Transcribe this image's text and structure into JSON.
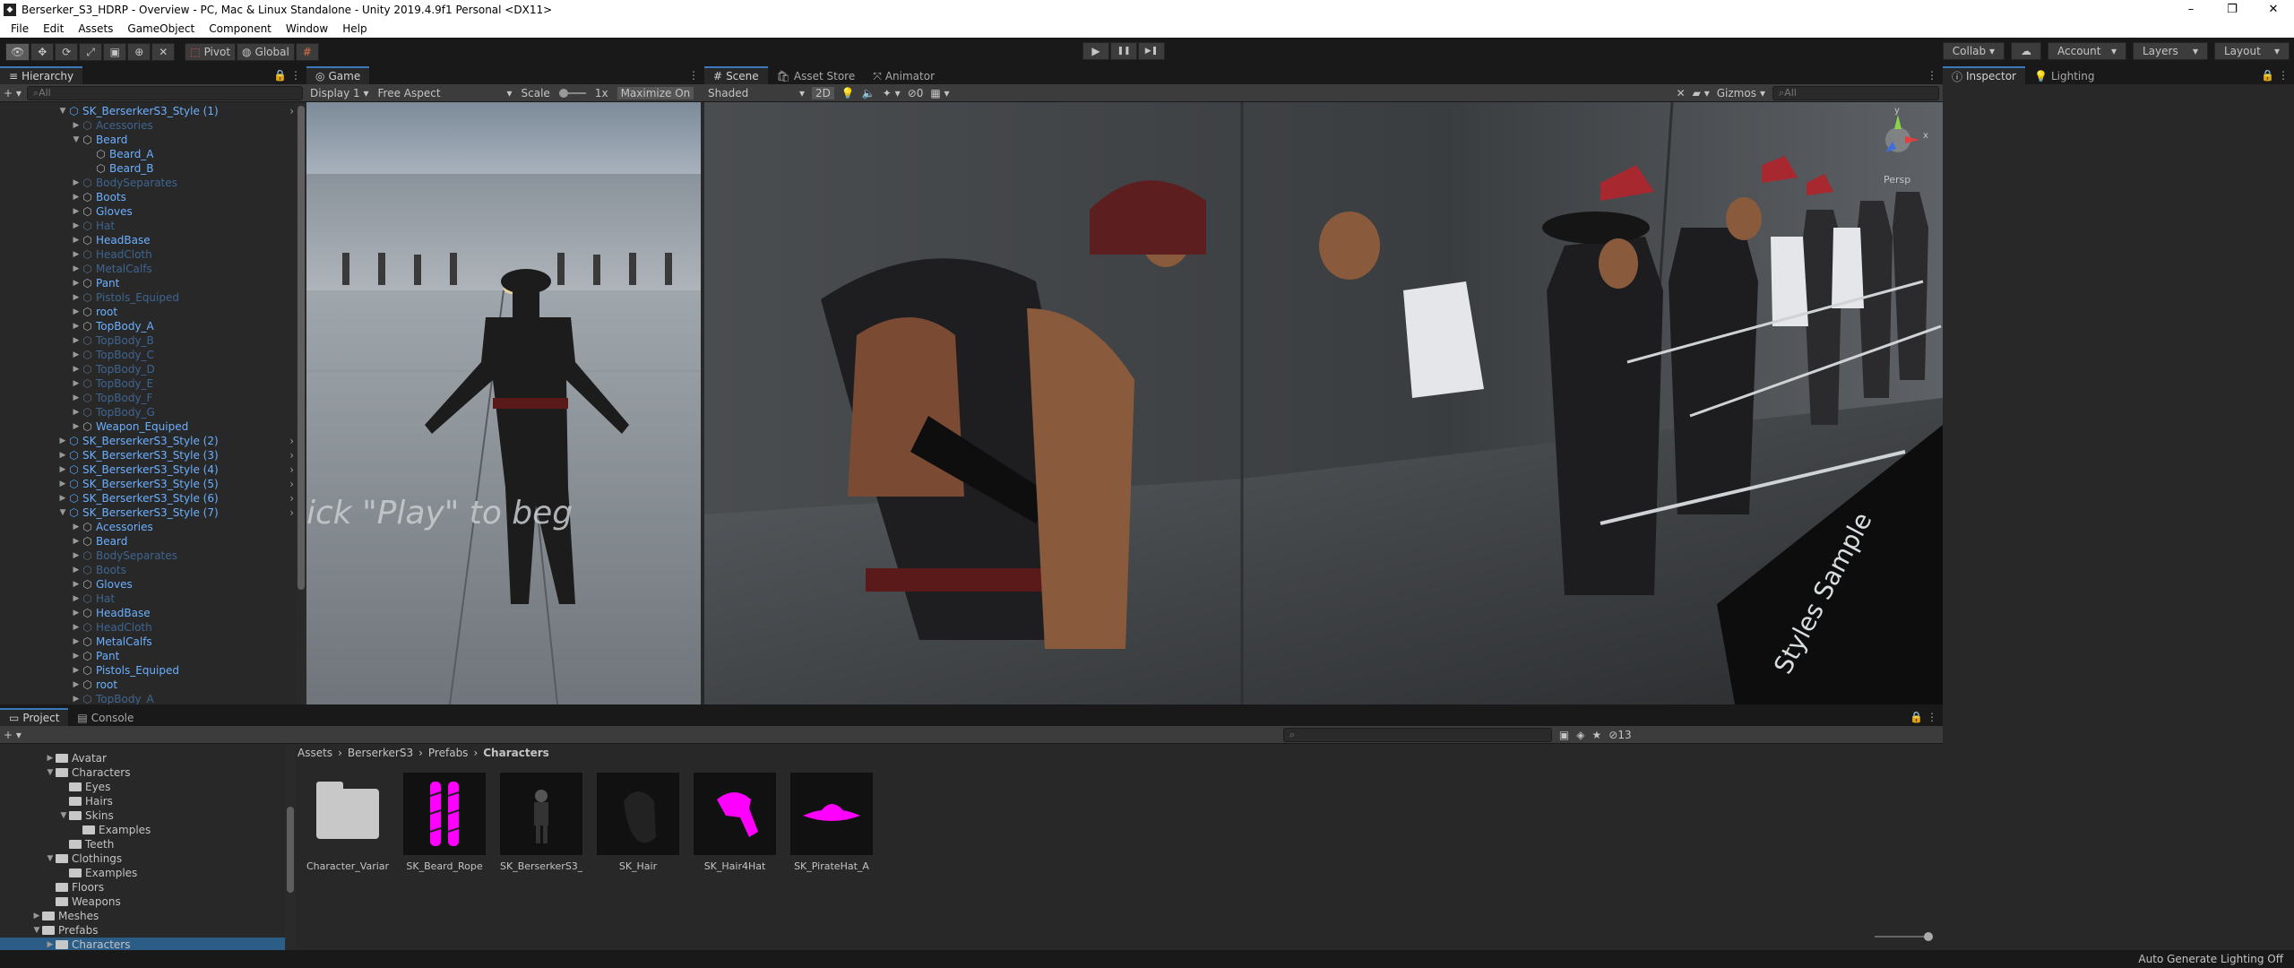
{
  "window": {
    "title": "Berserker_S3_HDRP - Overview - PC, Mac & Linux Standalone - Unity 2019.4.9f1 Personal <DX11>",
    "min": "–",
    "max": "❐",
    "close": "✕"
  },
  "menu": [
    "File",
    "Edit",
    "Assets",
    "GameObject",
    "Component",
    "Window",
    "Help"
  ],
  "toolbar": {
    "pivot": "Pivot",
    "global": "Global",
    "collab": "Collab ▾",
    "account": "Account",
    "layers": "Layers",
    "layout": "Layout",
    "play": "▶",
    "pause": "❚❚",
    "step": "▶❚"
  },
  "hierarchy": {
    "tab": "Hierarchy",
    "search": "All",
    "items": [
      {
        "label": "SK_BerserkerS3_Style (1)",
        "depth": 0,
        "exp": true,
        "prefab": true,
        "dim": false,
        "chev": true
      },
      {
        "label": "Acessories",
        "depth": 1,
        "exp": false,
        "dim": true
      },
      {
        "label": "Beard",
        "depth": 1,
        "exp": true,
        "dim": false
      },
      {
        "label": "Beard_A",
        "depth": 2,
        "dim": false
      },
      {
        "label": "Beard_B",
        "depth": 2,
        "dim": false
      },
      {
        "label": "BodySeparates",
        "depth": 1,
        "exp": false,
        "dim": true
      },
      {
        "label": "Boots",
        "depth": 1,
        "exp": false,
        "dim": false
      },
      {
        "label": "Gloves",
        "depth": 1,
        "exp": false,
        "dim": false
      },
      {
        "label": "Hat",
        "depth": 1,
        "exp": false,
        "dim": true
      },
      {
        "label": "HeadBase",
        "depth": 1,
        "exp": false,
        "dim": false
      },
      {
        "label": "HeadCloth",
        "depth": 1,
        "exp": false,
        "dim": true
      },
      {
        "label": "MetalCalfs",
        "depth": 1,
        "exp": false,
        "dim": true
      },
      {
        "label": "Pant",
        "depth": 1,
        "exp": false,
        "dim": false
      },
      {
        "label": "Pistols_Equiped",
        "depth": 1,
        "exp": false,
        "dim": true
      },
      {
        "label": "root",
        "depth": 1,
        "exp": false,
        "dim": false
      },
      {
        "label": "TopBody_A",
        "depth": 1,
        "exp": false,
        "dim": false
      },
      {
        "label": "TopBody_B",
        "depth": 1,
        "exp": false,
        "dim": true
      },
      {
        "label": "TopBody_C",
        "depth": 1,
        "exp": false,
        "dim": true
      },
      {
        "label": "TopBody_D",
        "depth": 1,
        "exp": false,
        "dim": true
      },
      {
        "label": "TopBody_E",
        "depth": 1,
        "exp": false,
        "dim": true
      },
      {
        "label": "TopBody_F",
        "depth": 1,
        "exp": false,
        "dim": true
      },
      {
        "label": "TopBody_G",
        "depth": 1,
        "exp": false,
        "dim": true
      },
      {
        "label": "Weapon_Equiped",
        "depth": 1,
        "exp": false,
        "dim": false
      },
      {
        "label": "SK_BerserkerS3_Style (2)",
        "depth": 0,
        "exp": false,
        "prefab": true,
        "dim": false,
        "chev": true
      },
      {
        "label": "SK_BerserkerS3_Style (3)",
        "depth": 0,
        "exp": false,
        "prefab": true,
        "dim": false,
        "chev": true
      },
      {
        "label": "SK_BerserkerS3_Style (4)",
        "depth": 0,
        "exp": false,
        "prefab": true,
        "dim": false,
        "chev": true
      },
      {
        "label": "SK_BerserkerS3_Style (5)",
        "depth": 0,
        "exp": false,
        "prefab": true,
        "dim": false,
        "chev": true
      },
      {
        "label": "SK_BerserkerS3_Style (6)",
        "depth": 0,
        "exp": false,
        "prefab": true,
        "dim": false,
        "chev": true
      },
      {
        "label": "SK_BerserkerS3_Style (7)",
        "depth": 0,
        "exp": true,
        "prefab": true,
        "dim": false,
        "chev": true
      },
      {
        "label": "Acessories",
        "depth": 1,
        "exp": false,
        "dim": false
      },
      {
        "label": "Beard",
        "depth": 1,
        "exp": false,
        "dim": false
      },
      {
        "label": "BodySeparates",
        "depth": 1,
        "exp": false,
        "dim": true
      },
      {
        "label": "Boots",
        "depth": 1,
        "exp": false,
        "dim": true
      },
      {
        "label": "Gloves",
        "depth": 1,
        "exp": false,
        "dim": false
      },
      {
        "label": "Hat",
        "depth": 1,
        "exp": false,
        "dim": true
      },
      {
        "label": "HeadBase",
        "depth": 1,
        "exp": false,
        "dim": false
      },
      {
        "label": "HeadCloth",
        "depth": 1,
        "exp": false,
        "dim": true
      },
      {
        "label": "MetalCalfs",
        "depth": 1,
        "exp": false,
        "dim": false
      },
      {
        "label": "Pant",
        "depth": 1,
        "exp": false,
        "dim": false
      },
      {
        "label": "Pistols_Equiped",
        "depth": 1,
        "exp": false,
        "dim": false
      },
      {
        "label": "root",
        "depth": 1,
        "exp": false,
        "dim": false
      },
      {
        "label": "TopBody_A",
        "depth": 1,
        "exp": false,
        "dim": true
      }
    ]
  },
  "game": {
    "tab": "Game",
    "display": "Display 1",
    "aspect": "Free Aspect",
    "scale_label": "Scale",
    "scale_value": "1x",
    "maximize": "Maximize On",
    "overlay": "lick \"Play\" to beg"
  },
  "scene": {
    "tab": "Scene",
    "asset_store_tab": "Asset Store",
    "animator_tab": "Animator",
    "shading": "Shaded",
    "mode_2d": "2D",
    "hidden_count": "0",
    "gizmos": "Gizmos",
    "search": "All",
    "persp": "Persp",
    "axis_y": "y",
    "axis_x": "x",
    "floor_text": "Styles Sample"
  },
  "inspector": {
    "tab": "Inspector",
    "lighting_tab": "Lighting"
  },
  "project": {
    "tab": "Project",
    "console_tab": "Console",
    "count": "13",
    "breadcrumb": [
      "Assets",
      "BerserkerS3",
      "Prefabs",
      "Characters"
    ],
    "tree": [
      {
        "label": "Avatar",
        "depth": 2,
        "exp": false
      },
      {
        "label": "Characters",
        "depth": 2,
        "exp": true
      },
      {
        "label": "Eyes",
        "depth": 3,
        "exp": null
      },
      {
        "label": "Hairs",
        "depth": 3,
        "exp": null
      },
      {
        "label": "Skins",
        "depth": 3,
        "exp": true
      },
      {
        "label": "Examples",
        "depth": 4,
        "exp": null
      },
      {
        "label": "Teeth",
        "depth": 3,
        "exp": null
      },
      {
        "label": "Clothings",
        "depth": 2,
        "exp": true
      },
      {
        "label": "Examples",
        "depth": 3,
        "exp": null
      },
      {
        "label": "Floors",
        "depth": 2,
        "exp": null
      },
      {
        "label": "Weapons",
        "depth": 2,
        "exp": null
      },
      {
        "label": "Meshes",
        "depth": 1,
        "exp": false
      },
      {
        "label": "Prefabs",
        "depth": 1,
        "exp": true
      },
      {
        "label": "Characters",
        "depth": 2,
        "exp": false,
        "sel": true
      }
    ],
    "assets": [
      {
        "name": "Character_Varian...",
        "kind": "folder"
      },
      {
        "name": "SK_Beard_Rope",
        "kind": "beard"
      },
      {
        "name": "SK_BerserkerS3_...",
        "kind": "char"
      },
      {
        "name": "SK_Hair",
        "kind": "hair"
      },
      {
        "name": "SK_Hair4Hat",
        "kind": "hair4hat"
      },
      {
        "name": "SK_PirateHat_A",
        "kind": "hat"
      }
    ]
  },
  "status": {
    "right": "Auto Generate Lighting Off"
  },
  "colors": {
    "accent": "#3a79bb",
    "prefab": "#6bb0ff",
    "magenta": "#ff00ff"
  }
}
